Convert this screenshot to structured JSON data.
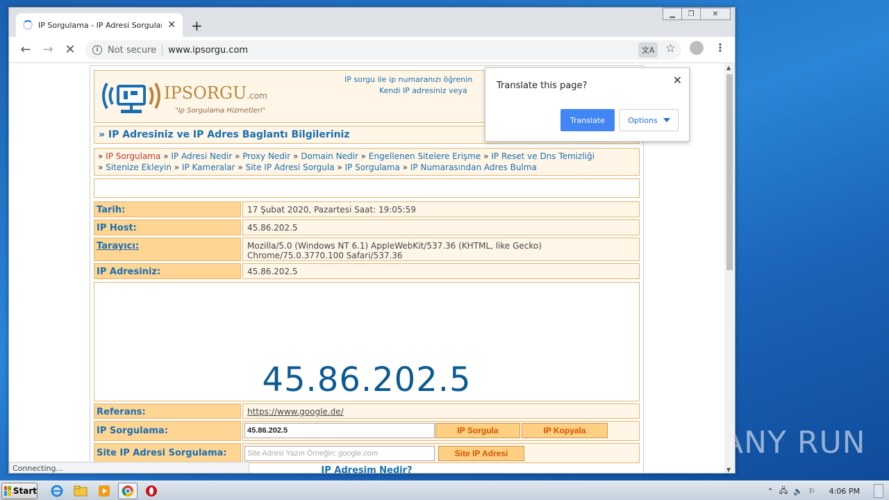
{
  "browser": {
    "tab_title": "IP Sorgulama - IP Adresi Sorgulama",
    "security": "Not secure",
    "url": "www.ipsorgu.com",
    "status": "Connecting..."
  },
  "translate_popup": {
    "question": "Translate this page?",
    "translate_label": "Translate",
    "options_label": "Options"
  },
  "page": {
    "logo_main": "IPSORGU",
    "logo_suffix": ".com",
    "logo_tagline": "\"Ip Sorgulama Hizmetleri\"",
    "intro_line1": "IP sorgu ile ip numaranızı öğrenin",
    "intro_line2": "Kendi IP adresiniz veya",
    "section_title": "» IP Adresiniz ve IP Adres Baglantı Bilgileriniz",
    "nav_links": [
      "IP Sorgulama",
      "IP Adresi Nedir",
      "Proxy Nedir",
      "Domain Nedir",
      "Engellenen Sitelere Erişme",
      "IP Reset ve Dns Temizliği",
      "Sitenize Ekleyin",
      "IP Kameralar",
      "Site IP Adresi Sorgula",
      "IP Sorgulama",
      "IP Numarasından Adres Bulma"
    ],
    "rows": {
      "date_label": "Tarih:",
      "date_value": "17 Şubat 2020, Pazartesi Saat: 19:05:59",
      "host_label": "IP Host:",
      "host_value": "45.86.202.5",
      "browser_label": "Tarayıcı:",
      "browser_value_1": "Mozilla/5.0 (Windows NT 6.1) AppleWebKit/537.36 (KHTML, like Gecko)",
      "browser_value_2": "Chrome/75.0.3770.100 Safari/537.36",
      "ip_label": "IP Adresiniz:",
      "ip_value": "45.86.202.5",
      "ref_label": "Referans:",
      "ref_value": "https://www.google.de/",
      "query_label": "IP Sorgulama:",
      "query_value": "45.86.202.5",
      "query_btn": "IP Sorgula",
      "copy_btn": "IP Kopyala",
      "site_label": "Site IP Adresi Sorgulama:",
      "site_placeholder": "Site Adresi Yazın Örneğin: google.com",
      "site_btn": "Site IP Adresi"
    },
    "big_ip": "45.86.202.5",
    "bottom_peek": "IP Adresim Nedir?"
  },
  "taskbar": {
    "start_label": "Start",
    "clock": "4:06 PM"
  },
  "watermark": "ANY RUN",
  "colors": {
    "accent_blue": "#1a6fb0",
    "label_bg": "#ffd594",
    "value_bg": "#fff6e8",
    "button_text": "#d35400",
    "chrome_blue": "#4285f4"
  }
}
